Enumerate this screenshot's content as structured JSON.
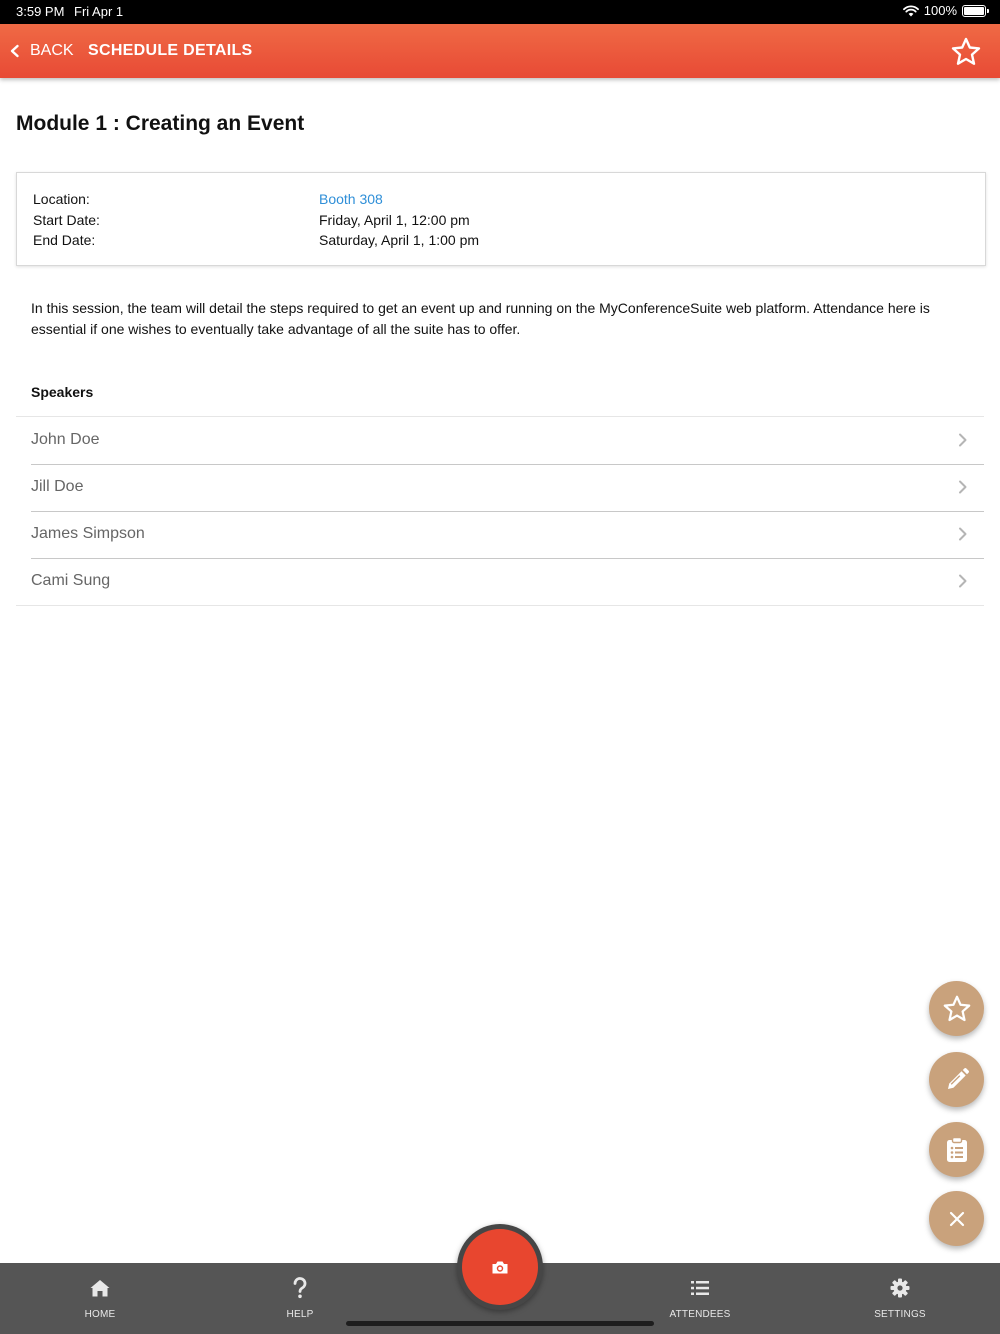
{
  "status_bar": {
    "time": "3:59 PM",
    "date": "Fri Apr 1",
    "battery": "100%"
  },
  "header": {
    "back_label": "BACK",
    "title": "SCHEDULE DETAILS",
    "accent_color": "#e84a35"
  },
  "page": {
    "title": "Module 1 : Creating an Event"
  },
  "info": {
    "location_label": "Location:",
    "location_value": "Booth 308",
    "start_label": "Start Date:",
    "start_value": "Friday, April 1, 12:00 pm",
    "end_label": "End Date:",
    "end_value": "Saturday, April 1, 1:00 pm"
  },
  "description": "In this session, the team will detail the steps required to get an event up and running on the MyConferenceSuite web platform. Attendance here is essential if one wishes to eventually take advantage of all the suite has to offer.",
  "speakers": {
    "heading": "Speakers",
    "items": [
      {
        "name": "John Doe"
      },
      {
        "name": "Jill Doe"
      },
      {
        "name": "James Simpson"
      },
      {
        "name": "Cami Sung"
      }
    ]
  },
  "fabs": [
    "star-icon",
    "pencil-icon",
    "clipboard-icon",
    "close-icon"
  ],
  "tabs": [
    {
      "label": "HOME",
      "icon": "home-icon"
    },
    {
      "label": "HELP",
      "icon": "question-icon"
    },
    {
      "label": "ATTENDEES",
      "icon": "list-icon"
    },
    {
      "label": "SETTINGS",
      "icon": "gear-icon"
    }
  ],
  "camera_icon": "camera-icon"
}
